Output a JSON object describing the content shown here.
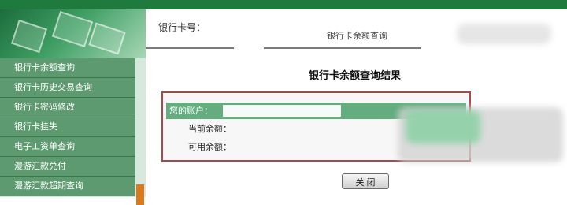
{
  "sidebar": {
    "items": [
      {
        "label": "银行卡余额查询"
      },
      {
        "label": "银行卡历史交易查询"
      },
      {
        "label": "银行卡密码修改"
      },
      {
        "label": "银行卡挂失"
      },
      {
        "label": "电子工资单查询"
      },
      {
        "label": "漫游汇款兑付"
      },
      {
        "label": "漫游汇款超期查询"
      }
    ]
  },
  "card": {
    "label": "银行卡号："
  },
  "tabs": {
    "active_label": "银行卡余额查询"
  },
  "result": {
    "title": "银行卡余额查询结果",
    "rows": [
      {
        "label": "您的账户："
      },
      {
        "label": "当前余额："
      },
      {
        "label": "可用余额："
      }
    ]
  },
  "actions": {
    "close_label": "关 闭"
  },
  "colors": {
    "top_bar": "#1f7a3d",
    "menu_bg": "#5d9a70",
    "accent_orange": "#d97a1e",
    "panel_border": "#a94a4a"
  }
}
